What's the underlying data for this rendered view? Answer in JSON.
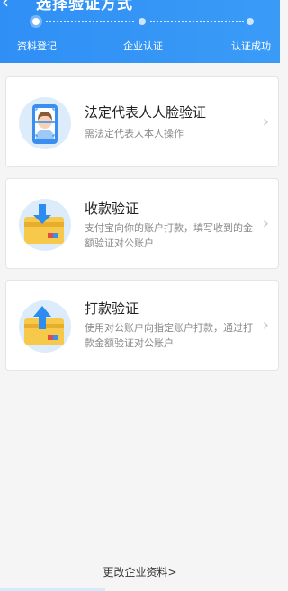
{
  "header": {
    "title": "选择验证方式",
    "back_icon": "chevron-left-icon"
  },
  "steps": [
    {
      "label": "资料登记",
      "active": true
    },
    {
      "label": "企业认证",
      "active": false
    },
    {
      "label": "认证成功",
      "active": false
    }
  ],
  "cards": [
    {
      "title": "法定代表人人脸验证",
      "desc": "需法定代表人本人操作",
      "icon": "face-scan-icon"
    },
    {
      "title": "收款验证",
      "desc": "支付宝向你的账户打款，填写收到的金额验证对公账户",
      "icon": "receive-payment-card-icon"
    },
    {
      "title": "打款验证",
      "desc": "使用对公账户向指定账户打款，通过打款金额验证对公账户",
      "icon": "send-payment-card-icon"
    }
  ],
  "footer": {
    "link_label": "更改企业资料>"
  },
  "colors": {
    "header": "#2f8ff5",
    "card_yellow": "#f7c94b",
    "arrow_blue": "#2c8cf0"
  }
}
